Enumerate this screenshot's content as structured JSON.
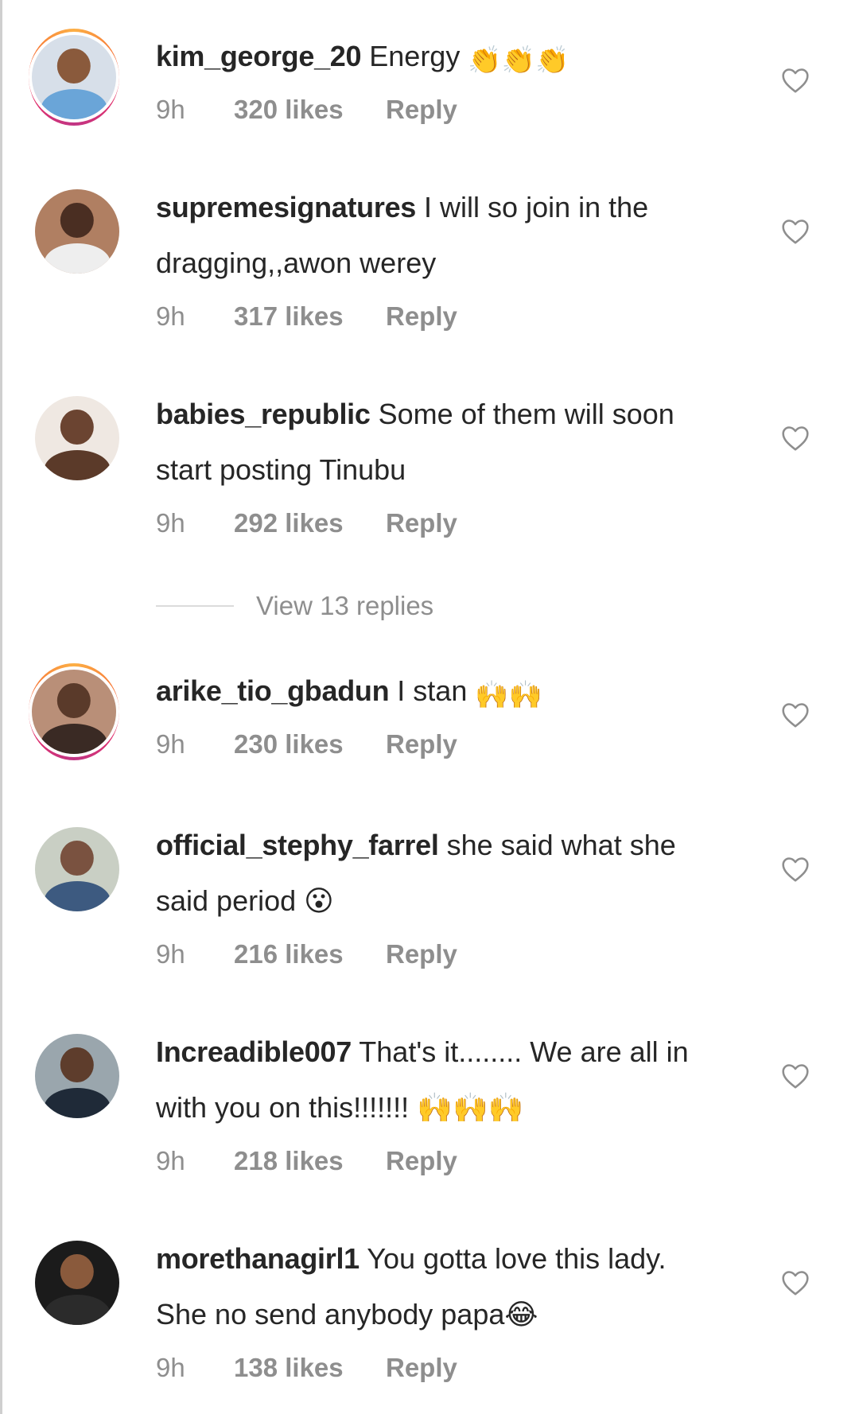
{
  "comments": [
    {
      "username": "kim_george_20",
      "text": "Energy",
      "emoji": "👏👏👏",
      "line2": "",
      "time": "9h",
      "likes": "320 likes",
      "reply": "Reply",
      "has_story_ring": true
    },
    {
      "username": "supremesignatures",
      "text": "I will so join in the",
      "emoji": "",
      "line2": "dragging,,awon werey",
      "time": "9h",
      "likes": "317 likes",
      "reply": "Reply",
      "has_story_ring": false
    },
    {
      "username": "babies_republic",
      "text": "Some of them will soon",
      "emoji": "",
      "line2": "start posting Tinubu",
      "time": "9h",
      "likes": "292 likes",
      "reply": "Reply",
      "has_story_ring": false
    },
    {
      "username": "arike_tio_gbadun",
      "text": "I stan",
      "emoji": "🙌🙌",
      "line2": "",
      "time": "9h",
      "likes": "230 likes",
      "reply": "Reply",
      "has_story_ring": true
    },
    {
      "username": "official_stephy_farrel",
      "text": "she said what she",
      "emoji": "",
      "line2": "said period 😮",
      "time": "9h",
      "likes": "216 likes",
      "reply": "Reply",
      "has_story_ring": false
    },
    {
      "username": "Increadible007",
      "text": "That's it........ We are all in",
      "emoji": "",
      "line2": "with you on this!!!!!!! 🙌🙌🙌",
      "time": "9h",
      "likes": "218 likes",
      "reply": "Reply",
      "has_story_ring": false
    },
    {
      "username": "morethanagirl1",
      "text": "You gotta love this lady.",
      "emoji": "",
      "line2": "She no send anybody papa😂",
      "time": "9h",
      "likes": "138 likes",
      "reply": "Reply",
      "has_story_ring": false
    }
  ],
  "view_replies": "View 13 replies",
  "icons": {
    "heart": "heart-outline-icon"
  },
  "colors": {
    "text_primary": "#262626",
    "text_secondary": "#8e8e8e",
    "divider": "#dbdbdb"
  }
}
